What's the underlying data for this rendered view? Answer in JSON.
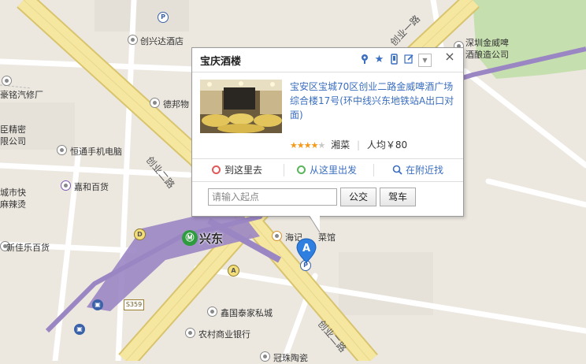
{
  "map": {
    "poi_labels": [
      "创兴达酒店",
      "豪铭汽修厂",
      "德邦物",
      "臣精密",
      "限公司",
      "恒通手机电脑",
      "城市快",
      "麻辣烫",
      "嘉和百货",
      "新佳乐百货",
      "海记",
      "菜馆",
      "鑫国泰家私城",
      "农村商业银行",
      "冠珠陶瓷",
      "深圳金威啤",
      "酒酿造公司"
    ],
    "road_labels": [
      "创业一路",
      "创业二路",
      "创业二路"
    ],
    "station": {
      "name": "兴东",
      "icon": "metro-icon"
    },
    "route_shield": "S359",
    "exit_labels": [
      "D",
      "A"
    ],
    "marker_letter": "A",
    "colors": {
      "metro_line": "#9b86c4",
      "road_yellow": "#f6e7a0",
      "green_area": "#c5dfae",
      "background": "#ece8e0"
    }
  },
  "popup": {
    "title": "宝庆酒楼",
    "tools": [
      "locate-icon",
      "favorite-icon",
      "phone-icon",
      "edit-icon",
      "dropdown-icon"
    ],
    "close_label": "×",
    "address": "宝安区宝城70区创业二路金威啤酒广场综合楼17号(环中线兴东地铁站A出口对面)",
    "rating": 4,
    "rating_max": 5,
    "cuisine": "湘菜",
    "avg_price_label": "人均￥80",
    "tabs": [
      "到这里去",
      "从这里出发",
      "在附近找"
    ],
    "start_placeholder": "请输入起点",
    "buttons": {
      "transit": "公交",
      "drive": "驾车"
    }
  }
}
